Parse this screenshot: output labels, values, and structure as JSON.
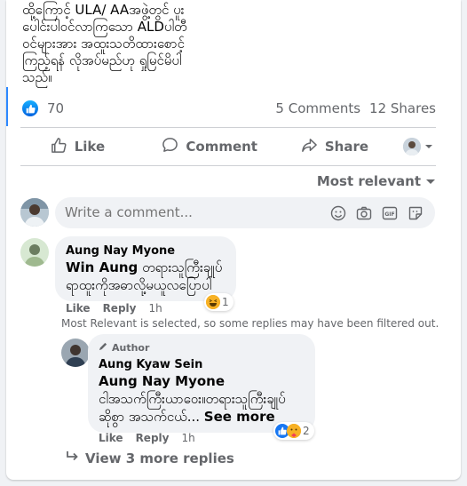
{
  "post": {
    "text": "ထို့ကြောင့် ULA/ AAအဖွဲ့တွင် ပူး\nပေါင်းပါဝင်လာကြသော ALDပါတီ\nဝင်များအား အထူးသတိထားစောင့်\nကြည့်ရန် လိုအပ်မည်ဟု ရှုမြင်မိပါ\nသည်။"
  },
  "reactions": {
    "count": "70",
    "comments": "5 Comments",
    "shares": "12 Shares",
    "colors": {
      "like": "#1877f2",
      "haha": "#f7b125"
    }
  },
  "actions": {
    "like": "Like",
    "comment": "Comment",
    "share": "Share"
  },
  "sort": {
    "label": "Most relevant"
  },
  "composer": {
    "placeholder": "Write a comment..."
  },
  "comments": [
    {
      "author": "Aung Nay Myone",
      "mention": "Win Aung",
      "text": " တရားသူကြီးချုပ်\nရာထူးကိုအဓာလို့မယူလပြောပါ",
      "like": "Like",
      "reply": "Reply",
      "time": "1h",
      "reaction_count": "1"
    }
  ],
  "filter_note": "Most Relevant is selected, so some replies may have been filtered out.",
  "reply": {
    "badge": "Author",
    "author": "Aung Kyaw Sein",
    "mention": "Aung Nay Myone",
    "text": "ငါအသက်ကြီးယာဝေး။တရားသူကြီးချုပ်\nဆိုစွာ အသက်ငယ်...",
    "see_more": "See more",
    "like": "Like",
    "reply": "Reply",
    "time": "1h",
    "reaction_count": "2"
  },
  "more_replies": {
    "label": "View 3 more replies"
  }
}
